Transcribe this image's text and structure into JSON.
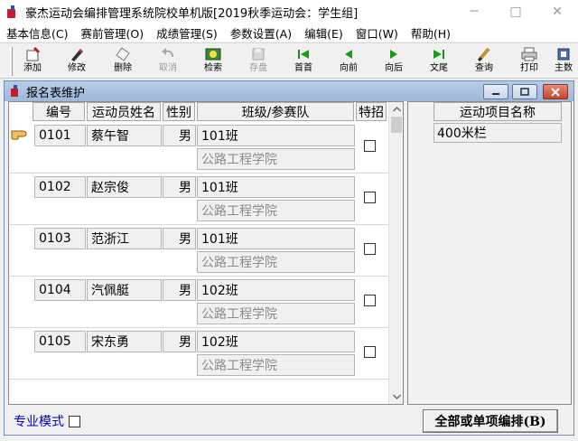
{
  "window": {
    "title": "豪杰运动会编排管理系统院校单机版[2019秋季运动会：学生组]",
    "minimize_glyph": "─",
    "maximize_glyph": "□",
    "close_glyph": "✕"
  },
  "menu": [
    "基本信息(C)",
    "赛前管理(O)",
    "成绩管理(S)",
    "参数设置(A)",
    "编辑(E)",
    "窗口(W)",
    "帮助(H)"
  ],
  "toolbar": [
    {
      "label": "添加",
      "icon": "add-icon",
      "enabled": true
    },
    {
      "label": "修改",
      "icon": "edit-icon",
      "enabled": true
    },
    {
      "label": "删除",
      "icon": "delete-icon",
      "enabled": true
    },
    {
      "label": "取消",
      "icon": "undo-icon",
      "enabled": false
    },
    {
      "label": "检索",
      "icon": "search-icon",
      "enabled": true
    },
    {
      "label": "存盘",
      "icon": "save-icon",
      "enabled": false
    },
    {
      "label": "首首",
      "icon": "first-icon",
      "enabled": true
    },
    {
      "label": "向前",
      "icon": "prev-icon",
      "enabled": true
    },
    {
      "label": "向后",
      "icon": "next-icon",
      "enabled": true
    },
    {
      "label": "文尾",
      "icon": "last-icon",
      "enabled": true
    },
    {
      "label": "查询",
      "icon": "query-icon",
      "enabled": true
    },
    {
      "label": "打印",
      "icon": "print-icon",
      "enabled": true
    },
    {
      "label": "主数",
      "icon": "main-data-icon",
      "enabled": true
    }
  ],
  "child_window": {
    "title": "报名表维护"
  },
  "grid": {
    "headers": [
      "编号",
      "运动员姓名",
      "性别",
      "班级/参赛队",
      "特招"
    ],
    "rows": [
      {
        "id": "0101",
        "name": "蔡午智",
        "gender": "男",
        "class": "101班",
        "school": "公路工程学院",
        "special": false
      },
      {
        "id": "0102",
        "name": "赵宗俊",
        "gender": "男",
        "class": "101班",
        "school": "公路工程学院",
        "special": false
      },
      {
        "id": "0103",
        "name": "范浙江",
        "gender": "男",
        "class": "101班",
        "school": "公路工程学院",
        "special": false
      },
      {
        "id": "0104",
        "name": "汽佩艇",
        "gender": "男",
        "class": "102班",
        "school": "公路工程学院",
        "special": false
      },
      {
        "id": "0105",
        "name": "宋东勇",
        "gender": "男",
        "class": "102班",
        "school": "公路工程学院",
        "special": false
      }
    ]
  },
  "events_panel": {
    "header": "运动项目名称",
    "items": [
      "400米栏"
    ]
  },
  "bottom": {
    "pro_mode_label": "专业模式",
    "arrange_button": "全部或单项编排(B)"
  }
}
